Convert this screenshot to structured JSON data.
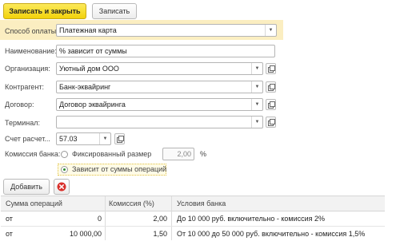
{
  "toolbar": {
    "save_close_label": "Записать и закрыть",
    "save_label": "Записать"
  },
  "form": {
    "payment_method": {
      "label": "Способ оплаты:",
      "value": "Платежная карта"
    },
    "name": {
      "label": "Наименование:",
      "value": "% зависит от суммы"
    },
    "organization": {
      "label": "Организация:",
      "value": "Уютный дом ООО"
    },
    "counterparty": {
      "label": "Контрагент:",
      "value": "Банк-эквайринг"
    },
    "contract": {
      "label": "Договор:",
      "value": "Договор эквайринга"
    },
    "terminal": {
      "label": "Терминал:",
      "value": ""
    },
    "account": {
      "label": "Счет расчет...",
      "value": "57.03"
    },
    "commission": {
      "label": "Комиссия банка:",
      "option_fixed": "Фиксированный размер",
      "fixed_value": "2,00",
      "percent_sign": "%",
      "option_depends": "Зависит от суммы операций",
      "selected": "depends"
    }
  },
  "table_toolbar": {
    "add_label": "Добавить",
    "delete_icon": "delete-icon"
  },
  "table": {
    "columns": [
      "Сумма операций",
      "Комиссия (%)",
      "Условия банка"
    ],
    "rows": [
      {
        "prefix": "от",
        "amount": "0",
        "commission": "2,00",
        "conditions": "До 10 000 руб. включительно - комиссия 2%"
      },
      {
        "prefix": "от",
        "amount": "10 000,00",
        "commission": "1,50",
        "conditions": "От 10 000 до 50 000 руб. включительно - комиссия 1,5%"
      }
    ]
  },
  "colors": {
    "primary_button": "#f2d20b",
    "highlight_row": "#fbeec1",
    "delete_red": "#d9302b",
    "radio_selected": "#2f8a2f"
  }
}
